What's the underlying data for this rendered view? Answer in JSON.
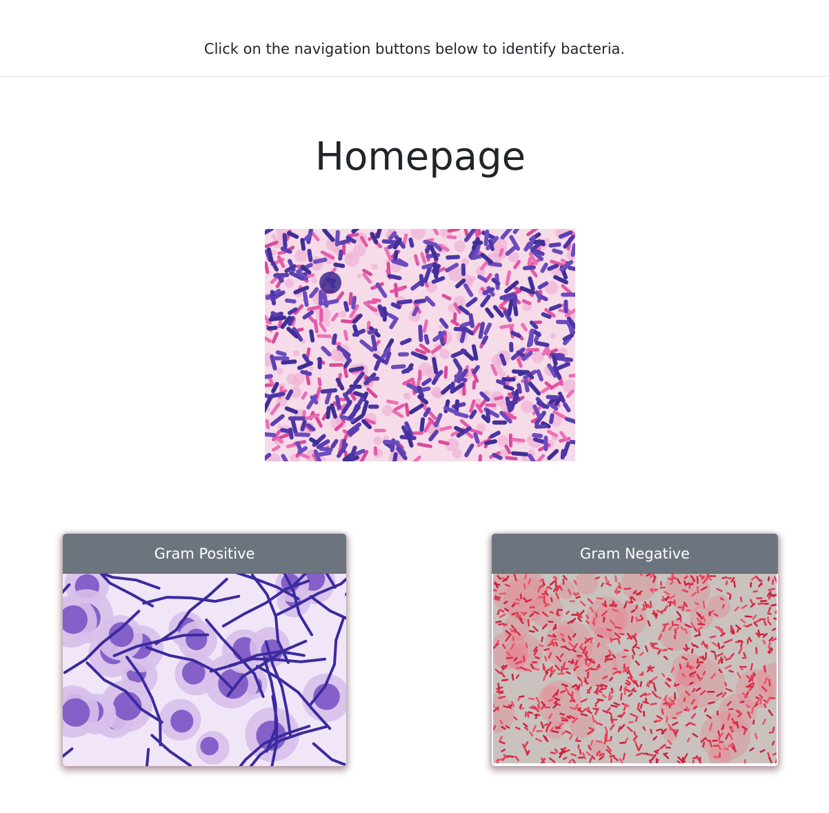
{
  "header": {
    "instructions": "Click on the navigation buttons below to identify bacteria."
  },
  "main": {
    "title": "Homepage",
    "hero_image": "gram-stain-micrograph"
  },
  "cards": [
    {
      "label": "Gram Positive",
      "image": "gram-positive-micrograph"
    },
    {
      "label": "Gram Negative",
      "image": "gram-negative-micrograph"
    }
  ],
  "colors": {
    "card_header_bg": "#6c757d",
    "card_header_text": "#ffffff",
    "title_text": "#212529",
    "divider": "#dee2e6"
  }
}
